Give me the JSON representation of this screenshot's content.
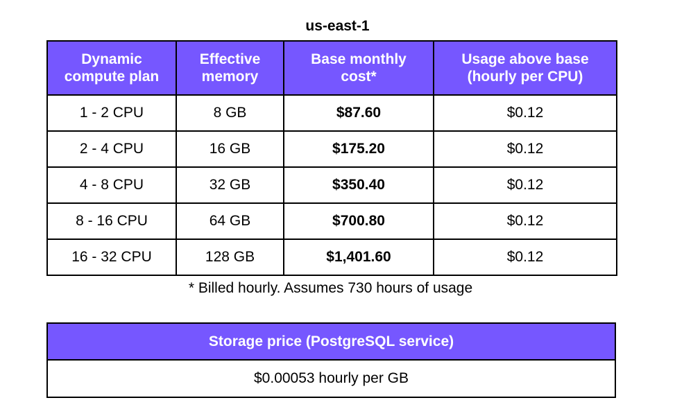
{
  "region": "us-east-1",
  "compute_table": {
    "headers": [
      {
        "line1": "Dynamic",
        "line2": "compute plan"
      },
      {
        "line1": "Effective",
        "line2": "memory"
      },
      {
        "line1": "Base monthly",
        "line2": "cost*"
      },
      {
        "line1": "Usage above base",
        "line2": "(hourly per CPU)"
      }
    ],
    "rows": [
      {
        "plan": "1 - 2 CPU",
        "memory": "8 GB",
        "base_cost": "$87.60",
        "usage": "$0.12"
      },
      {
        "plan": "2 - 4 CPU",
        "memory": "16 GB",
        "base_cost": "$175.20",
        "usage": "$0.12"
      },
      {
        "plan": "4 - 8 CPU",
        "memory": "32 GB",
        "base_cost": "$350.40",
        "usage": "$0.12"
      },
      {
        "plan": "8 - 16 CPU",
        "memory": "64 GB",
        "base_cost": "$700.80",
        "usage": "$0.12"
      },
      {
        "plan": "16 - 32 CPU",
        "memory": "128 GB",
        "base_cost": "$1,401.60",
        "usage": "$0.12"
      }
    ]
  },
  "footnote": "* Billed hourly. Assumes 730 hours of usage",
  "storage_table": {
    "header": "Storage price (PostgreSQL service)",
    "value": "$0.00053 hourly per GB"
  },
  "colors": {
    "header_bg": "#7657ff",
    "header_text": "#ffffff"
  }
}
